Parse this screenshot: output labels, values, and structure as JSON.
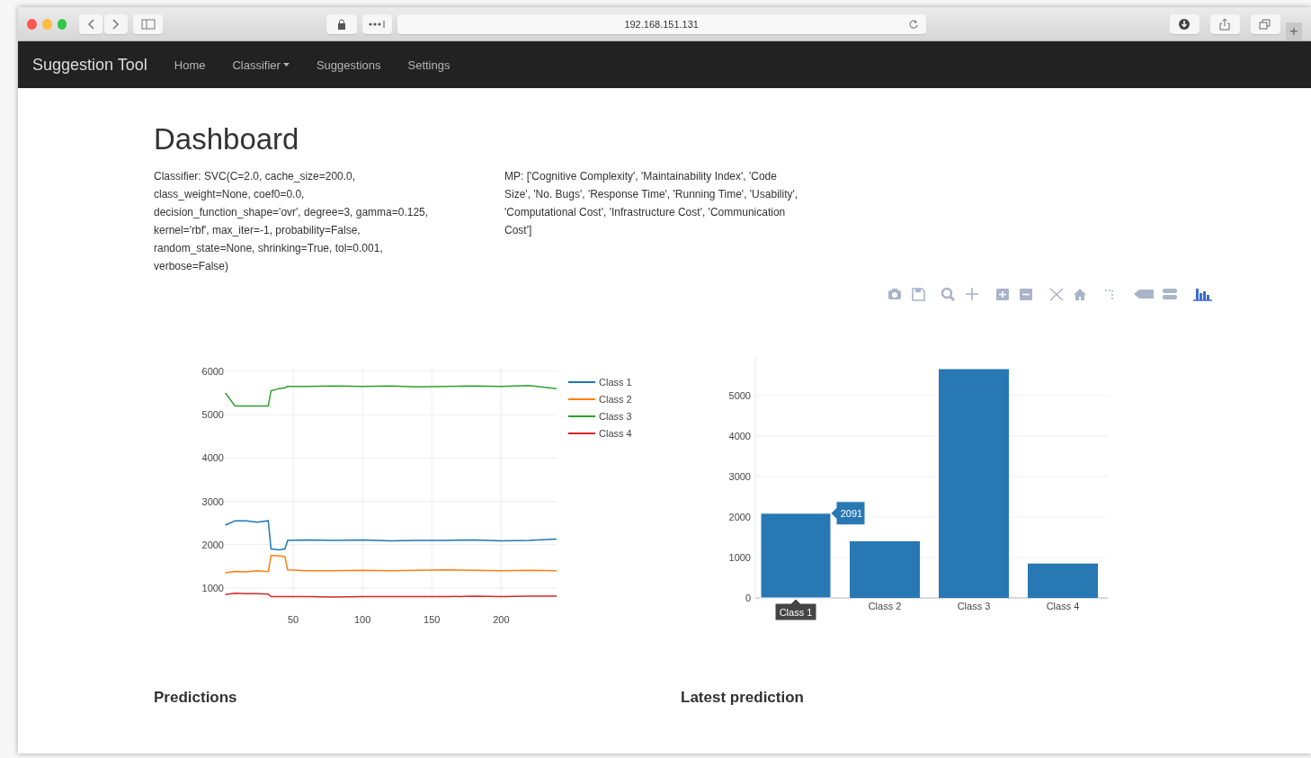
{
  "browser": {
    "url": "192.168.151.131",
    "new_tab": "+"
  },
  "navbar": {
    "brand": "Suggestion Tool",
    "items": [
      {
        "label": "Home",
        "dropdown": false
      },
      {
        "label": "Classifier",
        "dropdown": true
      },
      {
        "label": "Suggestions",
        "dropdown": false
      },
      {
        "label": "Settings",
        "dropdown": false
      }
    ]
  },
  "dashboard": {
    "title": "Dashboard",
    "classifier_text": "Classifier: SVC(C=2.0, cache_size=200.0, class_weight=None, coef0=0.0, decision_function_shape='ovr', degree=3, gamma=0.125, kernel='rbf', max_iter=-1, probability=False, random_state=None, shrinking=True, tol=0.001, verbose=False)",
    "mp_text": "MP: ['Cognitive Complexity', 'Maintainability Index', 'Code Size', 'No. Bugs', 'Response Time', 'Running Time', 'Usability', 'Computational Cost', 'Infrastructure Cost', 'Communication Cost']"
  },
  "modebar": {
    "tools": [
      {
        "kind": "camera",
        "selected": false
      },
      {
        "kind": "save",
        "selected": false
      },
      {
        "kind": "zoom",
        "selected": false
      },
      {
        "kind": "pan",
        "selected": false
      },
      {
        "kind": "zoom-in",
        "selected": false
      },
      {
        "kind": "zoom-out",
        "selected": false
      },
      {
        "kind": "autoscale",
        "selected": false
      },
      {
        "kind": "home",
        "selected": false
      },
      {
        "kind": "spike",
        "selected": false
      },
      {
        "kind": "hover-closest",
        "selected": false
      },
      {
        "kind": "hover-compare",
        "selected": false
      },
      {
        "kind": "bars",
        "selected": true
      }
    ]
  },
  "line_chart": {
    "chart_data": {
      "type": "line",
      "x": [
        1,
        8,
        16,
        24,
        32,
        34,
        40,
        44,
        46,
        60,
        80,
        100,
        120,
        140,
        160,
        180,
        200,
        220,
        240
      ],
      "series": [
        {
          "name": "Class 1",
          "color": "#1f77b4",
          "values": [
            2450,
            2550,
            2550,
            2520,
            2550,
            1900,
            1880,
            1900,
            2100,
            2110,
            2100,
            2110,
            2090,
            2100,
            2100,
            2110,
            2090,
            2100,
            2130
          ]
        },
        {
          "name": "Class 2",
          "color": "#ff7f0e",
          "values": [
            1350,
            1380,
            1370,
            1400,
            1380,
            1750,
            1740,
            1720,
            1420,
            1400,
            1400,
            1410,
            1400,
            1410,
            1420,
            1410,
            1400,
            1410,
            1400
          ]
        },
        {
          "name": "Class 3",
          "color": "#2ca02c",
          "values": [
            5500,
            5200,
            5200,
            5200,
            5200,
            5550,
            5600,
            5620,
            5650,
            5650,
            5660,
            5650,
            5660,
            5640,
            5650,
            5660,
            5650,
            5670,
            5600
          ]
        },
        {
          "name": "Class 4",
          "color": "#d62728",
          "values": [
            850,
            880,
            870,
            870,
            860,
            800,
            800,
            800,
            800,
            800,
            790,
            800,
            800,
            800,
            800,
            810,
            800,
            810,
            810
          ]
        }
      ],
      "xlim": [
        0,
        240
      ],
      "ylim": [
        750,
        6080
      ],
      "xticks": [
        50,
        100,
        150,
        200
      ],
      "yticks": [
        1000,
        2000,
        3000,
        4000,
        5000,
        6000
      ],
      "grid": true,
      "legend": true
    }
  },
  "bar_chart": {
    "chart_data": {
      "type": "bar",
      "categories": [
        "Class 1",
        "Class 2",
        "Class 3",
        "Class 4"
      ],
      "series": [
        {
          "color": "#2878b4",
          "values": [
            2091,
            1400,
            5650,
            850
          ]
        }
      ],
      "ylim": [
        0,
        5950
      ],
      "yticks": [
        0,
        1000,
        2000,
        3000,
        4000,
        5000
      ],
      "grid": true
    },
    "hovered": [
      true,
      false,
      false,
      false
    ],
    "hover_value_label": "2091"
  },
  "sections": [
    "Predictions",
    "Latest prediction"
  ]
}
